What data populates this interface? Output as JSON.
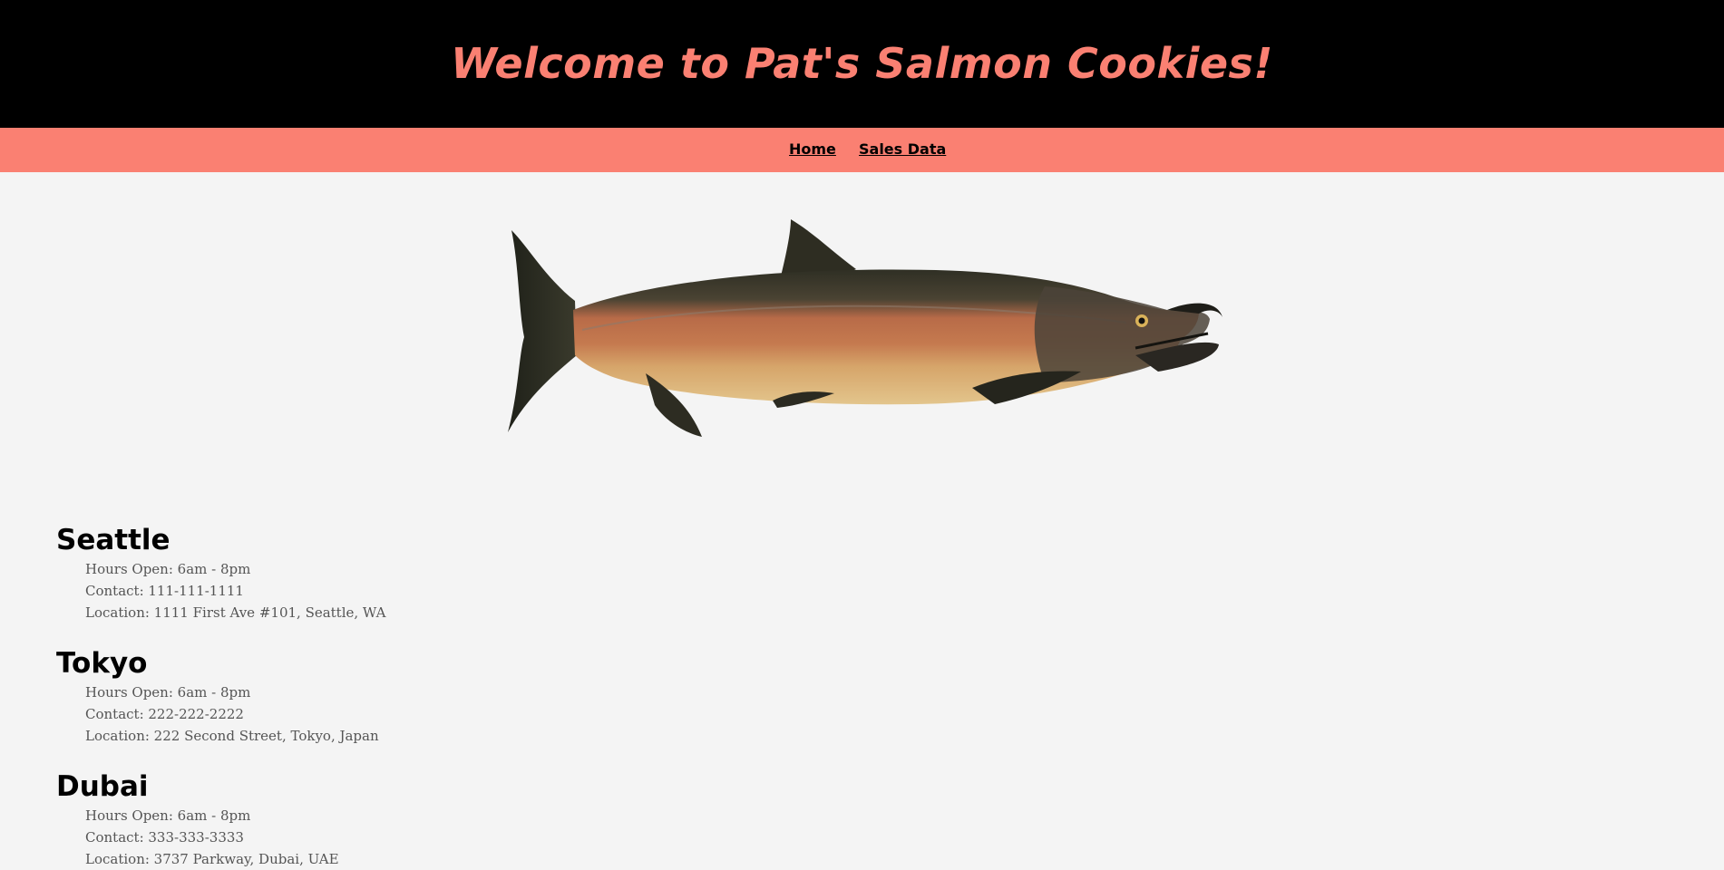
{
  "header": {
    "title": "Welcome to Pat's Salmon Cookies!"
  },
  "nav": {
    "home_label": "Home",
    "sales_label": "Sales Data"
  },
  "hero": {
    "image_subject": "salmon-fish-illustration"
  },
  "stores": [
    {
      "name": "Seattle",
      "hours": "Hours Open: 6am - 8pm",
      "contact": "Contact: 111-111-1111",
      "location": "Location: 1111 First Ave #101, Seattle, WA"
    },
    {
      "name": "Tokyo",
      "hours": "Hours Open: 6am - 8pm",
      "contact": "Contact: 222-222-2222",
      "location": "Location: 222 Second Street, Tokyo, Japan"
    },
    {
      "name": "Dubai",
      "hours": "Hours Open: 6am - 8pm",
      "contact": "Contact: 333-333-3333",
      "location": "Location: 3737 Parkway, Dubai, UAE"
    }
  ],
  "colors": {
    "accent_salmon": "#fa8072",
    "header_background": "#000000",
    "page_background": "#f4f4f4",
    "detail_text": "#555555"
  }
}
